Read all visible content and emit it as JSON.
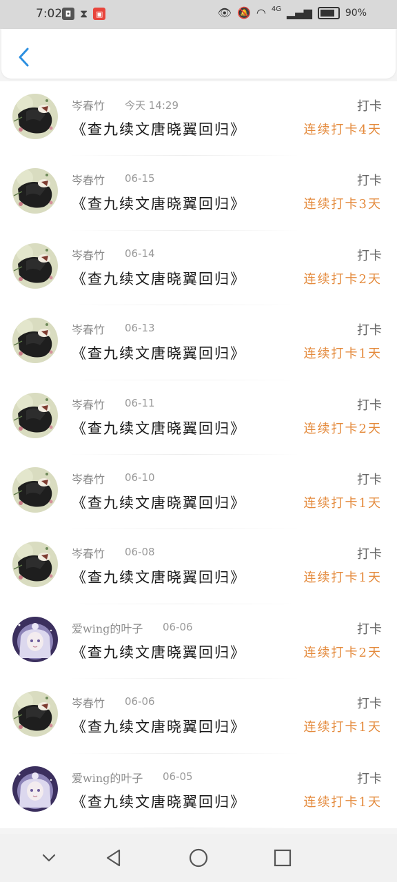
{
  "status_bar": {
    "time": "7:02",
    "network": "4G",
    "battery": "90%",
    "battery_level": 0.9
  },
  "colors": {
    "accent": "#2c8fe0",
    "streak": "#e48a3c"
  },
  "header": {
    "back_icon": "chevron-left-icon"
  },
  "checkins": [
    {
      "user": "岑春竹",
      "date": "今天 14:29",
      "book": "《查九续文唐晓翼回归》",
      "label": "打卡",
      "streak": "连续打卡4天",
      "avatar": "dark"
    },
    {
      "user": "岑春竹",
      "date": "06-15",
      "book": "《查九续文唐晓翼回归》",
      "label": "打卡",
      "streak": "连续打卡3天",
      "avatar": "dark"
    },
    {
      "user": "岑春竹",
      "date": "06-14",
      "book": "《查九续文唐晓翼回归》",
      "label": "打卡",
      "streak": "连续打卡2天",
      "avatar": "dark"
    },
    {
      "user": "岑春竹",
      "date": "06-13",
      "book": "《查九续文唐晓翼回归》",
      "label": "打卡",
      "streak": "连续打卡1天",
      "avatar": "dark"
    },
    {
      "user": "岑春竹",
      "date": "06-11",
      "book": "《查九续文唐晓翼回归》",
      "label": "打卡",
      "streak": "连续打卡2天",
      "avatar": "dark"
    },
    {
      "user": "岑春竹",
      "date": "06-10",
      "book": "《查九续文唐晓翼回归》",
      "label": "打卡",
      "streak": "连续打卡1天",
      "avatar": "dark"
    },
    {
      "user": "岑春竹",
      "date": "06-08",
      "book": "《查九续文唐晓翼回归》",
      "label": "打卡",
      "streak": "连续打卡1天",
      "avatar": "dark"
    },
    {
      "user": "爱wing的叶子",
      "date": "06-06",
      "book": "《查九续文唐晓翼回归》",
      "label": "打卡",
      "streak": "连续打卡2天",
      "avatar": "light"
    },
    {
      "user": "岑春竹",
      "date": "06-06",
      "book": "《查九续文唐晓翼回归》",
      "label": "打卡",
      "streak": "连续打卡1天",
      "avatar": "dark"
    },
    {
      "user": "爱wing的叶子",
      "date": "06-05",
      "book": "《查九续文唐晓翼回归》",
      "label": "打卡",
      "streak": "连续打卡1天",
      "avatar": "light"
    }
  ],
  "nav": {
    "icons": [
      "chevron-down-icon",
      "back-triangle-icon",
      "home-circle-icon",
      "recents-square-icon"
    ]
  }
}
